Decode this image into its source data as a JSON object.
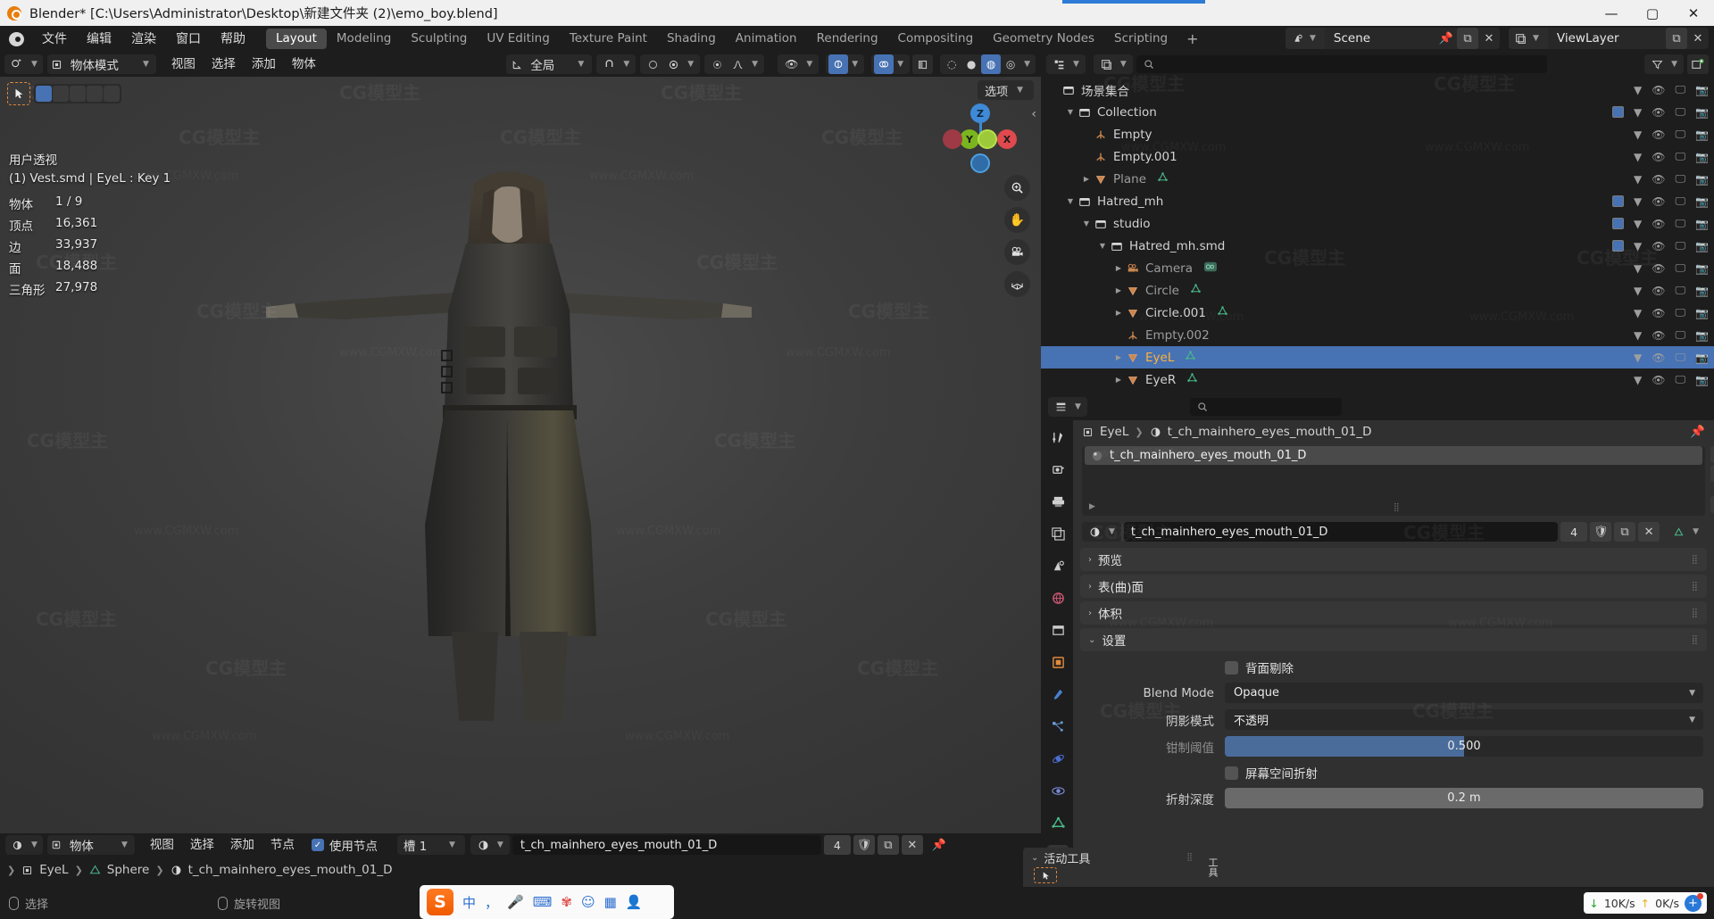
{
  "title_bar": {
    "app_title": "Blender* [C:\\Users\\Administrator\\Desktop\\新建文件夹 (2)\\emo_boy.blend]",
    "minimize": "—",
    "maximize": "▢",
    "close": "✕"
  },
  "menu_bar": {
    "items": [
      "文件",
      "编辑",
      "渲染",
      "窗口",
      "帮助"
    ],
    "workspace_tabs": [
      {
        "label": "Layout",
        "active": true
      },
      {
        "label": "Modeling",
        "active": false
      },
      {
        "label": "Sculpting",
        "active": false
      },
      {
        "label": "UV Editing",
        "active": false
      },
      {
        "label": "Texture Paint",
        "active": false
      },
      {
        "label": "Shading",
        "active": false
      },
      {
        "label": "Animation",
        "active": false
      },
      {
        "label": "Rendering",
        "active": false
      },
      {
        "label": "Compositing",
        "active": false
      },
      {
        "label": "Geometry Nodes",
        "active": false
      },
      {
        "label": "Scripting",
        "active": false
      }
    ],
    "add_workspace": "+",
    "scene_name": "Scene",
    "view_layer_name": "ViewLayer"
  },
  "viewport": {
    "mode": "物体模式",
    "menus": [
      "视图",
      "选择",
      "添加",
      "物体"
    ],
    "transform_orientation": "全局",
    "options_label": "选项",
    "stats": {
      "perspective": "用户透视",
      "object_line": "(1) Vest.smd | EyeL : Key 1",
      "rows": [
        {
          "label": "物体",
          "value": "1 / 9"
        },
        {
          "label": "顶点",
          "value": "16,361"
        },
        {
          "label": "边",
          "value": "33,937"
        },
        {
          "label": "面",
          "value": "18,488"
        },
        {
          "label": "三角形",
          "value": "27,978"
        }
      ]
    },
    "gizmo_axes": [
      "Z",
      "Y",
      "X"
    ],
    "nav_icons": [
      "zoom-icon",
      "hand-icon",
      "camera-icon",
      "grid-icon"
    ]
  },
  "shader_editor": {
    "object_label": "物体",
    "menus": [
      "视图",
      "选择",
      "添加",
      "节点"
    ],
    "use_nodes_label": "使用节点",
    "use_nodes_checked": true,
    "slot_label": "槽 1",
    "material_name": "t_ch_mainhero_eyes_mouth_01_D",
    "material_users": "4",
    "breadcrumb": [
      "EyeL",
      "Sphere",
      "t_ch_mainhero_eyes_mouth_01_D"
    ]
  },
  "outliner": {
    "search_placeholder": "",
    "rows": [
      {
        "label": "场景集合",
        "icon": "collection-icon",
        "indent": 0,
        "disclosure": "",
        "selected": false,
        "dim": false
      },
      {
        "label": "Collection",
        "icon": "collection-icon",
        "indent": 1,
        "disclosure": "▼",
        "selected": false,
        "dim": false
      },
      {
        "label": "Empty",
        "icon": "empty-axes-icon",
        "indent": 2,
        "disclosure": "",
        "selected": false,
        "dim": false
      },
      {
        "label": "Empty.001",
        "icon": "empty-axes-icon",
        "indent": 2,
        "disclosure": "",
        "selected": false,
        "dim": false
      },
      {
        "label": "Plane",
        "icon": "mesh-icon",
        "indent": 2,
        "disclosure": "▶",
        "selected": false,
        "dim": true
      },
      {
        "label": "Hatred_mh",
        "icon": "collection-icon",
        "indent": 1,
        "disclosure": "▼",
        "selected": false,
        "dim": false
      },
      {
        "label": "studio",
        "icon": "collection-icon",
        "indent": 2,
        "disclosure": "▼",
        "selected": false,
        "dim": false
      },
      {
        "label": "Hatred_mh.smd",
        "icon": "collection-icon",
        "indent": 3,
        "disclosure": "▼",
        "selected": false,
        "dim": false
      },
      {
        "label": "Camera",
        "icon": "camera-obj-icon",
        "indent": 4,
        "disclosure": "▶",
        "selected": false,
        "dim": true
      },
      {
        "label": "Circle",
        "icon": "mesh-icon",
        "indent": 4,
        "disclosure": "▶",
        "selected": false,
        "dim": true
      },
      {
        "label": "Circle.001",
        "icon": "mesh-icon",
        "indent": 4,
        "disclosure": "▶",
        "selected": false,
        "dim": false
      },
      {
        "label": "Empty.002",
        "icon": "empty-axes-icon",
        "indent": 4,
        "disclosure": "",
        "selected": false,
        "dim": true
      },
      {
        "label": "EyeL",
        "icon": "mesh-icon",
        "indent": 4,
        "disclosure": "▶",
        "selected": true,
        "dim": false
      },
      {
        "label": "EyeR",
        "icon": "mesh-icon",
        "indent": 4,
        "disclosure": "▶",
        "selected": false,
        "dim": false
      }
    ]
  },
  "properties": {
    "breadcrumb_object": "EyeL",
    "breadcrumb_material": "t_ch_mainhero_eyes_mouth_01_D",
    "material_slot_name": "t_ch_mainhero_eyes_mouth_01_D",
    "material_field_name": "t_ch_mainhero_eyes_mouth_01_D",
    "material_users": "4",
    "sections": [
      {
        "label": "预览",
        "open": false
      },
      {
        "label": "表(曲)面",
        "open": false
      },
      {
        "label": "体积",
        "open": false
      },
      {
        "label": "设置",
        "open": true
      }
    ],
    "settings": {
      "backface_culling_label": "背面剔除",
      "backface_culling_checked": false,
      "blend_mode_label": "Blend Mode",
      "blend_mode_value": "Opaque",
      "shadow_mode_label": "阴影模式",
      "shadow_mode_value": "不透明",
      "clip_threshold_label": "钳制阈值",
      "clip_threshold_value": "0.500",
      "screen_refraction_label": "屏幕空间折射",
      "screen_refraction_checked": false,
      "refraction_depth_label": "折射深度",
      "refraction_depth_value": "0.2 m"
    }
  },
  "active_tool_panel": {
    "title": "活动工具",
    "side_tab": "工具"
  },
  "status_bar": {
    "select_label": "选择",
    "rotate_view_label": "旋转视图"
  },
  "taskbar": {
    "ime_logo": "S",
    "ime_items": [
      "中",
      "，",
      "mic-icon",
      "keyboard-icon",
      "tools-icon",
      "emoji-icon",
      "apps-icon",
      "person-icon"
    ],
    "net_down": "10K/s",
    "net_up": "0K/s"
  },
  "watermarks": {
    "big": "CG模型主",
    "small": "www.CGMXW.com"
  },
  "colors": {
    "accent_blue": "#4772b3",
    "orange": "#e87d0d",
    "select_orange": "#ffb13b",
    "mesh_icon": "#d08a50",
    "green_data": "#48b98a"
  }
}
